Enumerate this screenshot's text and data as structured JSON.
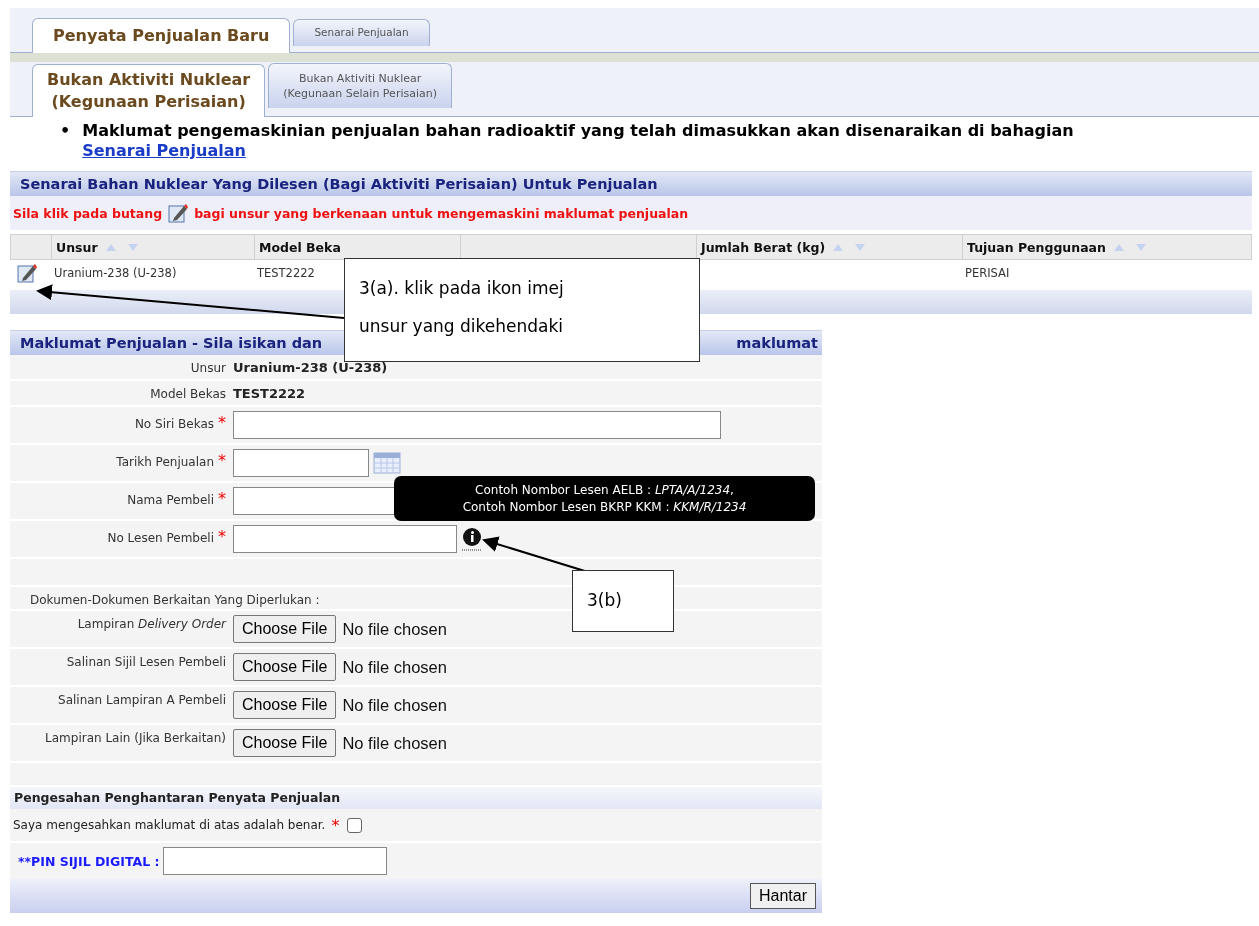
{
  "tabs": [
    {
      "label": "Penyata Penjualan Baru",
      "selected": true
    },
    {
      "label": "Senarai Penjualan",
      "selected": false
    }
  ],
  "subtabs": [
    {
      "lines": [
        "Bukan Aktiviti Nuklear",
        "(Kegunaan Perisaian)"
      ],
      "selected": true
    },
    {
      "lines": [
        "Bukan Aktiviti Nuklear",
        "(Kegunaan Selain Perisaian)"
      ],
      "selected": false
    }
  ],
  "notice": {
    "bullet": "•",
    "text": "Maklumat pengemaskinian penjualan bahan radioaktif yang telah dimasukkan akan disenaraikan di bahagian",
    "link": "Senarai Penjualan"
  },
  "licensed_list": {
    "title": "Senarai Bahan Nuklear Yang Dilesen (Bagi Aktiviti Perisaian) Untuk Penjualan",
    "instruction_before": "Sila klik pada butang",
    "instruction_after": "bagi unsur yang berkenaan untuk mengemaskini maklumat penjualan",
    "columns": [
      {
        "label": "Unsur",
        "sortable": true
      },
      {
        "label": "Model Beka",
        "sortable": false
      },
      {
        "sortable": false
      },
      {
        "label": "Jumlah Berat (kg)",
        "sortable": true
      },
      {
        "label": "Tujuan Penggunaan",
        "sortable": true
      }
    ],
    "rows": [
      {
        "cells": [
          "Uranium-238 (U-238)",
          "TEST2222",
          "",
          "",
          "PERISAI"
        ]
      }
    ]
  },
  "required_mark": "*",
  "form": {
    "title_start": "Maklumat Penjualan - Sila isikan dan",
    "title_end": "maklumat",
    "fields": [
      {
        "kind": "static",
        "label": "Unsur",
        "value": "Uranium-238 (U-238)"
      },
      {
        "kind": "static",
        "label": "Model Bekas",
        "value": "TEST2222"
      },
      {
        "kind": "text",
        "label": "No Siri Bekas",
        "required": true,
        "long": true
      },
      {
        "kind": "date",
        "label": "Tarikh Penjualan",
        "required": true
      },
      {
        "kind": "text",
        "label": "Nama Pembeli",
        "required": true,
        "long": false
      },
      {
        "kind": "info",
        "label": "No Lesen Pembeli",
        "required": true
      },
      {
        "kind": "blank"
      }
    ],
    "tooltip": [
      "Contoh Nombor Lesen AELB : *LPTA/A/1234*,",
      "Contoh Nombor Lesen BKRP KKM : *KKM/R/1234*"
    ],
    "documents_title": "Dokumen-Dokumen Berkaitan Yang Diperlukan :",
    "documents": [
      {
        "label": "Lampiran *Delivery Order*",
        "button": "Choose File",
        "status": "No file chosen"
      },
      {
        "label": "Salinan Sijil Lesen Pembeli",
        "button": "Choose File",
        "status": "No file chosen"
      },
      {
        "label": "Salinan Lampiran A Pembeli",
        "button": "Choose File",
        "status": "No file chosen"
      },
      {
        "label": "Lampiran Lain (Jika Berkaitan)",
        "button": "Choose File",
        "status": "No file chosen"
      }
    ]
  },
  "confirmation": {
    "title": "Pengesahan Penghantaran Penyata Penjualan",
    "statement": "Saya mengesahkan maklumat di atas adalah benar.",
    "required": true,
    "checked": false,
    "pin_label": "**PIN SIJIL DIGITAL :",
    "submit": "Hantar"
  },
  "annotations": [
    {
      "lines": [
        "3(a). klik pada ikon imej",
        "unsur yang dikehendaki"
      ]
    },
    {
      "lines": [
        "3(b)"
      ]
    }
  ]
}
